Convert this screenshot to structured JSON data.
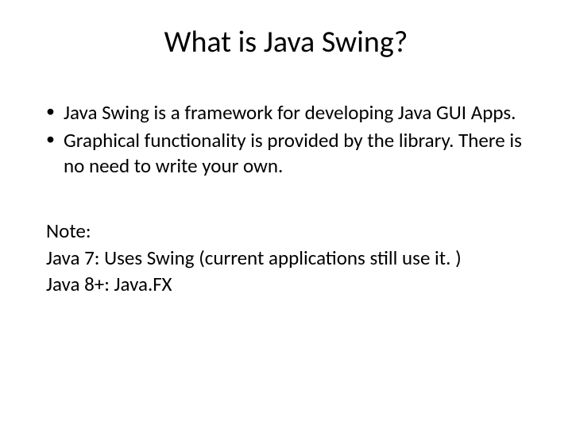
{
  "title": "What is Java Swing?",
  "bullets": [
    "Java Swing is a framework for developing Java GUI Apps.",
    "Graphical functionality is provided by the library. There is no need to write your own."
  ],
  "note": {
    "heading": "Note:",
    "line1": "Java 7: Uses Swing (current applications still use it. )",
    "line2": "Java 8+: Java.FX"
  }
}
